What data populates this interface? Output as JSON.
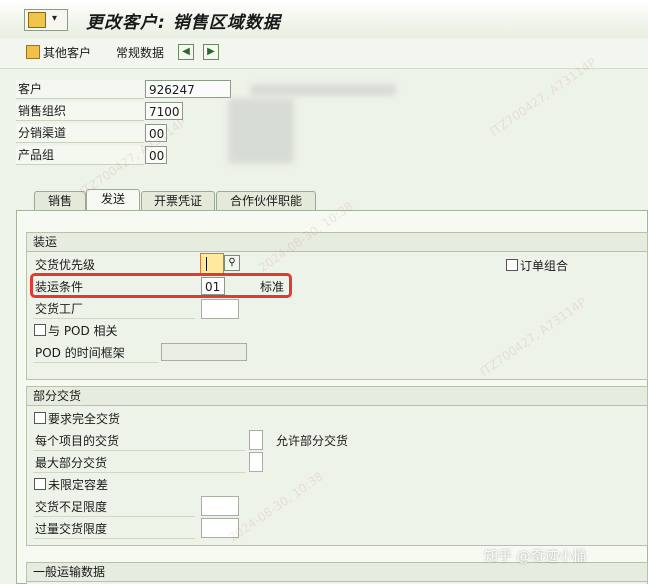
{
  "window": {
    "title": "更改客户: 销售区域数据"
  },
  "toolbar": {
    "other_customer": "其他客户",
    "general_data": "常规数据"
  },
  "header": {
    "customer_label": "客户",
    "customer_value": "926247",
    "sales_org_label": "销售组织",
    "sales_org_value": "7100",
    "dist_channel_label": "分销渠道",
    "dist_channel_value": "00",
    "division_label": "产品组",
    "division_value": "00"
  },
  "tabs": [
    {
      "label": "销售"
    },
    {
      "label": "发送"
    },
    {
      "label": "开票凭证"
    },
    {
      "label": "合作伙伴职能"
    }
  ],
  "shipping": {
    "title": "装运",
    "delivery_priority_label": "交货优先级",
    "shipping_cond_label": "装运条件",
    "shipping_cond_value": "01",
    "shipping_cond_text": "标准",
    "delivering_plant_label": "交货工厂",
    "pod_relevant_label": "与 POD 相关",
    "pod_timeframe_label": "POD 的时间框架",
    "order_combination_label": "订单组合"
  },
  "partial": {
    "title": "部分交货",
    "complete_delivery_label": "要求完全交货",
    "per_item_label": "每个项目的交货",
    "per_item_text": "允许部分交货",
    "max_partial_label": "最大部分交货",
    "unlimited_tol_label": "未限定容差",
    "under_tol_label": "交货不足限度",
    "over_tol_label": "过量交货限度"
  },
  "general": {
    "title": "一般运输数据"
  },
  "watermark": {
    "id": "ITZ700427, A73114P",
    "time": "2024-08-30, 10:38",
    "site": "知乎 @奇迹小桶"
  },
  "colors": {
    "highlight": "#e23a30",
    "tab_border": "#9aaa92",
    "panel_bg": "#f7faf3"
  }
}
